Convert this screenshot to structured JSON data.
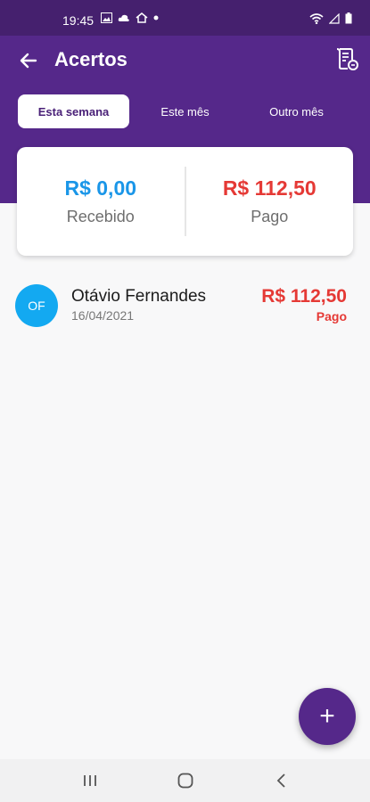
{
  "status_bar": {
    "time": "19:45"
  },
  "header": {
    "title": "Acertos"
  },
  "tabs": [
    {
      "label": "Esta semana",
      "active": true
    },
    {
      "label": "Este mês",
      "active": false
    },
    {
      "label": "Outro mês",
      "active": false
    }
  ],
  "summary": {
    "received": {
      "amount": "R$ 0,00",
      "label": "Recebido"
    },
    "paid": {
      "amount": "R$ 112,50",
      "label": "Pago"
    }
  },
  "settlements": [
    {
      "initials": "OF",
      "name": "Otávio Fernandes",
      "date": "16/04/2021",
      "amount": "R$ 112,50",
      "status": "Pago"
    }
  ],
  "fab": {
    "label": "+"
  },
  "colors": {
    "primary": "#55288a",
    "received": "#1a96e8",
    "paid": "#e53935",
    "avatar": "#13a9f1"
  }
}
